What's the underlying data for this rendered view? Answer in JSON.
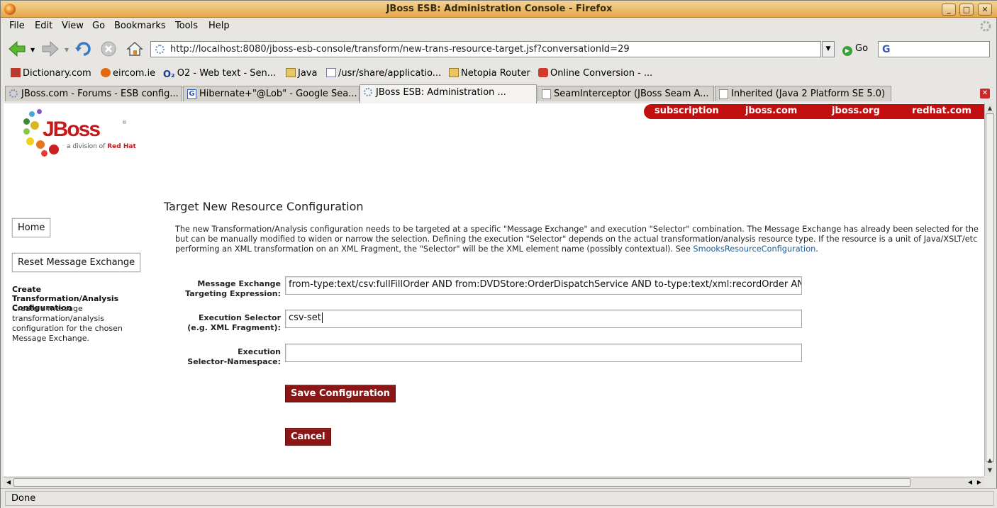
{
  "window": {
    "title": "JBoss ESB: Administration Console - Firefox",
    "minimize": "_",
    "maximize": "□",
    "close": "✕"
  },
  "menu": [
    "File",
    "Edit",
    "View",
    "Go",
    "Bookmarks",
    "Tools",
    "Help"
  ],
  "navbar": {
    "url": "http://localhost:8080/jboss-esb-console/transform/new-trans-resource-target.jsf?conversationId=29",
    "go_label": "Go",
    "search_value": ""
  },
  "bookmarks": [
    {
      "label": "Dictionary.com",
      "icon": "dictionary-icon"
    },
    {
      "label": "eircom.ie",
      "icon": "eircom-icon"
    },
    {
      "label": "O2 - Web text - Sen...",
      "icon": "o2-icon"
    },
    {
      "label": "Java",
      "icon": "folder-icon"
    },
    {
      "label": "/usr/share/applicatio...",
      "icon": "page-icon"
    },
    {
      "label": "Netopia Router",
      "icon": "folder-icon"
    },
    {
      "label": "Online Conversion - ...",
      "icon": "conversion-icon"
    }
  ],
  "tabs": [
    {
      "label": "JBoss.com - Forums - ESB config...",
      "active": false
    },
    {
      "label": "Hibernate+\"@Lob\" - Google Sea...",
      "active": false
    },
    {
      "label": "JBoss ESB: Administration ...",
      "active": true
    },
    {
      "label": "SeamInterceptor (JBoss Seam A...",
      "active": false
    },
    {
      "label": "Inherited (Java 2 Platform SE 5.0)",
      "active": false
    }
  ],
  "header_links": [
    "subscription",
    "jboss.com",
    "jboss.org",
    "redhat.com"
  ],
  "logo": {
    "brand": "JBoss",
    "tagline_prefix": "a division of",
    "tagline_brand": "Red Hat",
    "reg": "®"
  },
  "page": {
    "title": "Target New Resource Configuration",
    "intro_line1": "The new Transformation/Analysis configuration needs to be targeted at a specific \"Message Exchange\" and execution \"Selector\" combination. The Message Exchange has already been selected for the",
    "intro_line2": "but can be manually modified to widen or narrow the selection. Defining the execution \"Selector\" depends on the actual transformation/analysis resource type. If the resource is a unit of Java/XSLT/etc",
    "intro_line3": "performing an XML transformation on an XML Fragment, the \"Selector\" will be the XML element name (possibly contextual). See ",
    "intro_link": "SmooksResourceConfiguration",
    "intro_end": "."
  },
  "sidebar": {
    "home": "Home",
    "reset": "Reset Message Exchange",
    "section_title_1": "Create Transformation/Analysis",
    "section_title_2": "Configuration",
    "section_text": "Create a message transformation/analysis configuration for the chosen Message Exchange."
  },
  "form": {
    "mex_label_1": "Message Exchange",
    "mex_label_2": "Targeting Expression:",
    "mex_value": "from-type:text/csv:fullFillOrder AND from:DVDStore:OrderDispatchService AND to-type:text/xml:recordOrder AND",
    "sel_label_1": "Execution Selector",
    "sel_label_2": "(e.g. XML Fragment):",
    "sel_value": "csv-set",
    "ns_label_1": "Execution",
    "ns_label_2": "Selector-Namespace:",
    "ns_value": "",
    "save": "Save Configuration",
    "cancel": "Cancel"
  },
  "status": "Done"
}
